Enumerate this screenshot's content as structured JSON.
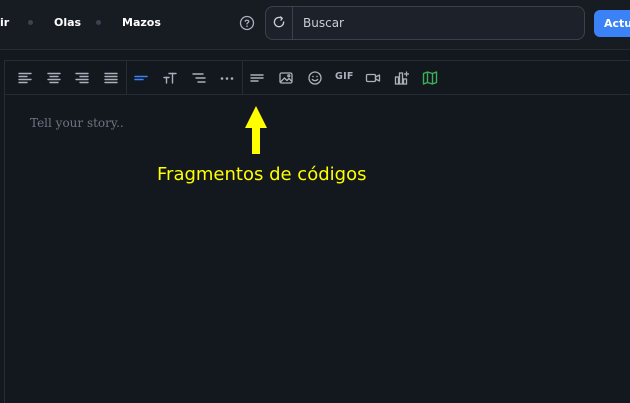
{
  "nav": {
    "items": [
      {
        "label": "ir"
      },
      {
        "label": "Olas"
      },
      {
        "label": "Mazos"
      }
    ]
  },
  "search": {
    "placeholder": "Buscar"
  },
  "header": {
    "update_label": "Actu"
  },
  "toolbar": {
    "gif_label": "GIF",
    "icons": [
      "align-left-icon",
      "align-center-icon",
      "align-right-icon",
      "align-justify-icon",
      "heading-icon",
      "text-size-icon",
      "list-icon",
      "more-icon",
      "code-block-icon",
      "image-icon",
      "emoji-icon",
      "gif-icon",
      "video-icon",
      "chart-icon",
      "map-icon"
    ]
  },
  "editor": {
    "placeholder": "Tell your story.."
  },
  "annotation": {
    "text": "Fragmentos de códigos",
    "color": "#ffff00"
  },
  "colors": {
    "accent": "#3b82f6",
    "background": "#13171e",
    "map_icon": "#3fae5a"
  }
}
